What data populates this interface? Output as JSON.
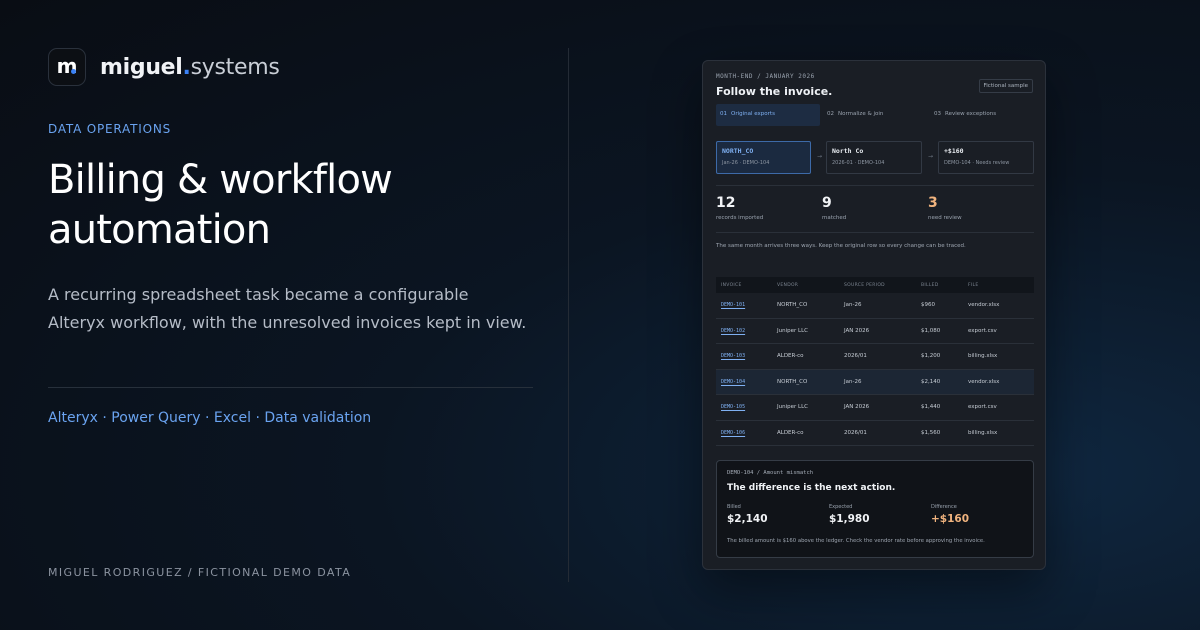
{
  "brand": {
    "mark": "m",
    "name_bold": "miguel",
    "name_dot": ".",
    "name_rest": "systems"
  },
  "left": {
    "eyebrow": "DATA OPERATIONS",
    "headline": "Billing & workflow automation",
    "lede": "A recurring spreadsheet task became a configurable Alteryx workflow, with the unresolved invoices kept in view.",
    "tools": "Alteryx · Power Query · Excel · Data validation",
    "footer": "MIGUEL RODRIGUEZ / FICTIONAL DEMO DATA"
  },
  "card": {
    "eyebrow": "MONTH-END / JANUARY 2026",
    "title": "Follow the invoice.",
    "badge": "Fictional sample",
    "tabs": [
      {
        "num": "01",
        "label": "Original exports"
      },
      {
        "num": "02",
        "label": "Normalize & join"
      },
      {
        "num": "03",
        "label": "Review exceptions"
      }
    ],
    "flow": [
      {
        "line1": "NORTH_CO",
        "line2": "Jan-26 · DEMO-104"
      },
      {
        "line1": "North Co",
        "line2": "2026-01 · DEMO-104"
      },
      {
        "line1": "+$160",
        "line2": "DEMO-104 · Needs review"
      }
    ],
    "arrow": "→",
    "stats": [
      {
        "value": "12",
        "label": "records imported"
      },
      {
        "value": "9",
        "label": "matched"
      },
      {
        "value": "3",
        "label": "need review"
      }
    ],
    "note": "The same month arrives three ways. Keep the original row so every change can be traced.",
    "table": {
      "columns": [
        "INVOICE",
        "VENDOR",
        "SOURCE PERIOD",
        "BILLED",
        "FILE"
      ],
      "rows": [
        [
          "DEMO-101",
          "NORTH_CO",
          "Jan-26",
          "$960",
          "vendor.xlsx"
        ],
        [
          "DEMO-102",
          "Juniper LLC",
          "JAN 2026",
          "$1,080",
          "export.csv"
        ],
        [
          "DEMO-103",
          "ALDER-co",
          "2026/01",
          "$1,200",
          "billing.xlsx"
        ],
        [
          "DEMO-104",
          "NORTH_CO",
          "Jan-26",
          "$2,140",
          "vendor.xlsx"
        ],
        [
          "DEMO-105",
          "Juniper LLC",
          "JAN 2026",
          "$1,440",
          "export.csv"
        ],
        [
          "DEMO-106",
          "ALDER-co",
          "2026/01",
          "$1,560",
          "billing.xlsx"
        ]
      ]
    },
    "detail": {
      "eyebrow": "DEMO-104 / Amount mismatch",
      "title": "The difference is the next action.",
      "metrics": [
        {
          "label": "Billed",
          "value": "$2,140"
        },
        {
          "label": "Expected",
          "value": "$1,980"
        },
        {
          "label": "Difference",
          "value": "+$160"
        }
      ],
      "footer": "The billed amount is $160 above the ledger. Check the vendor rate before approving the invoice."
    }
  },
  "colors": {
    "accent": "#6aa3f0",
    "warning": "#f0b37e",
    "background": "#0b1522"
  }
}
